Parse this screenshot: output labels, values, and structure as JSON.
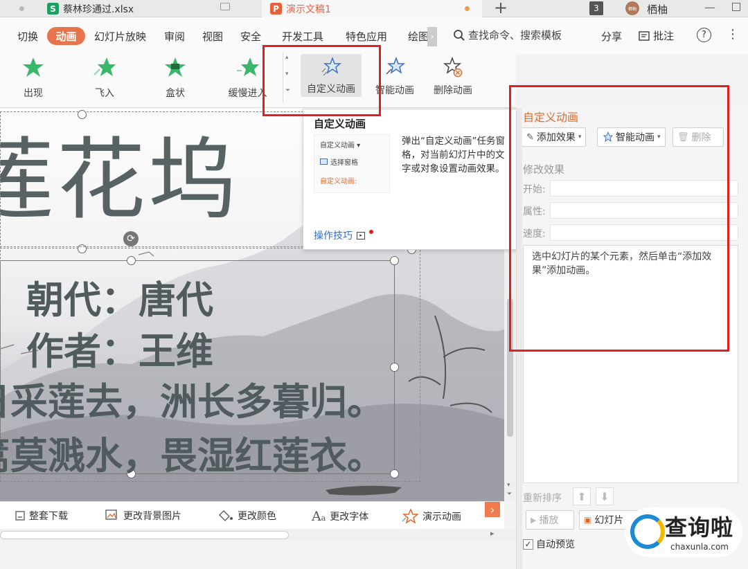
{
  "tabs": [
    {
      "title": "蔡林珍通过.xlsx",
      "app": "S",
      "app_color": "#1aa15f"
    },
    {
      "title": "演示文稿1",
      "app": "P",
      "app_color": "#e8613a"
    }
  ],
  "tab_count_badge": "3",
  "user_name": "栖柚",
  "user_avatar_text": "栖柚",
  "menu": {
    "items": [
      "切换",
      "动画",
      "幻灯片放映",
      "审阅",
      "视图",
      "安全",
      "开发工具",
      "特色应用",
      "绘图"
    ],
    "search": "查找命令、搜索模板",
    "share": "分享",
    "annotate": "批注",
    "help": "?",
    "more": "⋮"
  },
  "ribbon": {
    "animations": [
      "出现",
      "飞入",
      "盒状",
      "缓慢进入"
    ],
    "custom_animation": "自定义动画",
    "smart_animation": "智能动画",
    "delete_animation": "删除动画"
  },
  "slide": {
    "title": "莲花坞",
    "line1": "朝代：唐代",
    "line2": "作者：王维",
    "line3": "日日采莲去，洲长多暮归。",
    "line4": "弄篙莫溅水，畏湿红莲衣。"
  },
  "popup": {
    "title": "自定义动画",
    "preview_line1": "自定义动画 ▾",
    "preview_line2": "选择窗格",
    "preview_line3": "自定义动画:",
    "description": "弹出“自定义动画”任务窗格，对当前幻灯片中的文字或对象设置动画效果。",
    "tips_link": "操作技巧"
  },
  "bottom_toolbar": {
    "download_all": "整套下载",
    "change_background": "更改背景图片",
    "change_color": "更改颜色",
    "change_font": "更改字体",
    "demo_animation": "演示动画",
    "arrow": "›"
  },
  "panel": {
    "title": "自定义动画",
    "add_effect": "添加效果",
    "smart_animation": "智能动画",
    "delete": "删除",
    "modify_effect": "修改效果",
    "start_label": "开始:",
    "property_label": "属性:",
    "speed_label": "速度:",
    "hint": "选中幻灯片的某个元素，然后单击“添加效果”添加动画。",
    "reorder": "重新排序",
    "play": "播放",
    "slideshow": "幻灯片",
    "auto_preview": "自动预览"
  },
  "watermark": {
    "text": "查询啦",
    "url": "chaxunla.com"
  },
  "colors": {
    "accent": "#e8744c",
    "highlight_box": "#e02020",
    "panel_title": "#e06a2a",
    "link": "#2f6fcf"
  }
}
